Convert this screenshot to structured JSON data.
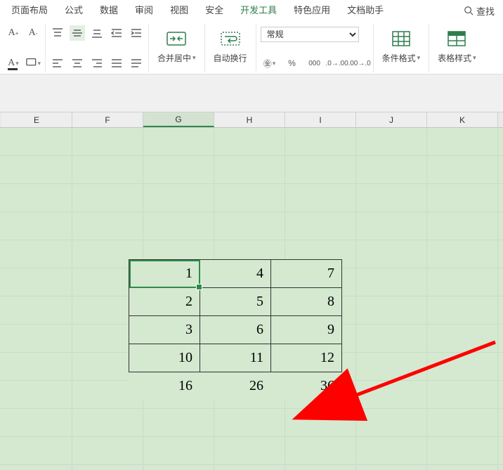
{
  "menu": {
    "tabs": [
      "页面布局",
      "公式",
      "数据",
      "审阅",
      "视图",
      "安全",
      "开发工具",
      "特色应用",
      "文档助手"
    ],
    "active_tab": "开发工具",
    "search_label": "查找"
  },
  "ribbon": {
    "merge_label": "合并居中",
    "wrap_label": "自动换行",
    "number_format": "常规",
    "cond_format_label": "条件格式",
    "table_style_label": "表格样式"
  },
  "sheet": {
    "columns": [
      "E",
      "F",
      "G",
      "H",
      "I",
      "J",
      "K"
    ],
    "active_column": "G",
    "data": {
      "rows": [
        {
          "g": "1",
          "h": "4",
          "i": "7"
        },
        {
          "g": "2",
          "h": "5",
          "i": "8"
        },
        {
          "g": "3",
          "h": "6",
          "i": "9"
        },
        {
          "g": "10",
          "h": "11",
          "i": "12"
        }
      ],
      "sums": {
        "g": "16",
        "h": "26",
        "i": "36"
      }
    },
    "active_cell": {
      "col": "G",
      "row_index": 0
    }
  }
}
